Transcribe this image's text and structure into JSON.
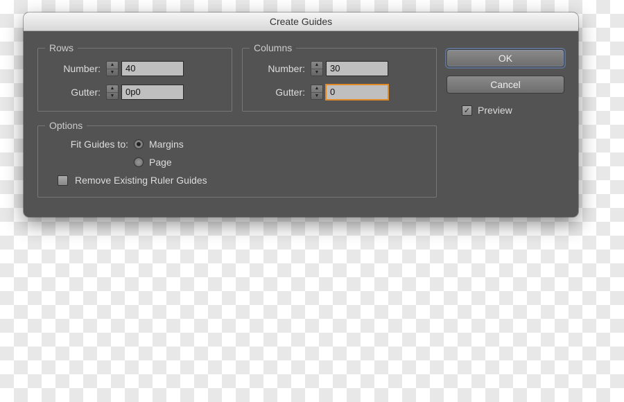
{
  "title": "Create Guides",
  "rows": {
    "legend": "Rows",
    "numberLabel": "Number:",
    "numberValue": "40",
    "gutterLabel": "Gutter:",
    "gutterValue": "0p0"
  },
  "columns": {
    "legend": "Columns",
    "numberLabel": "Number:",
    "numberValue": "30",
    "gutterLabel": "Gutter:",
    "gutterValue": "0"
  },
  "options": {
    "legend": "Options",
    "fitLabel": "Fit Guides to:",
    "margins": "Margins",
    "page": "Page",
    "fitSelected": "margins",
    "removeLabel": "Remove Existing Ruler Guides",
    "removeChecked": false
  },
  "buttons": {
    "ok": "OK",
    "cancel": "Cancel"
  },
  "preview": {
    "label": "Preview",
    "checked": true
  }
}
